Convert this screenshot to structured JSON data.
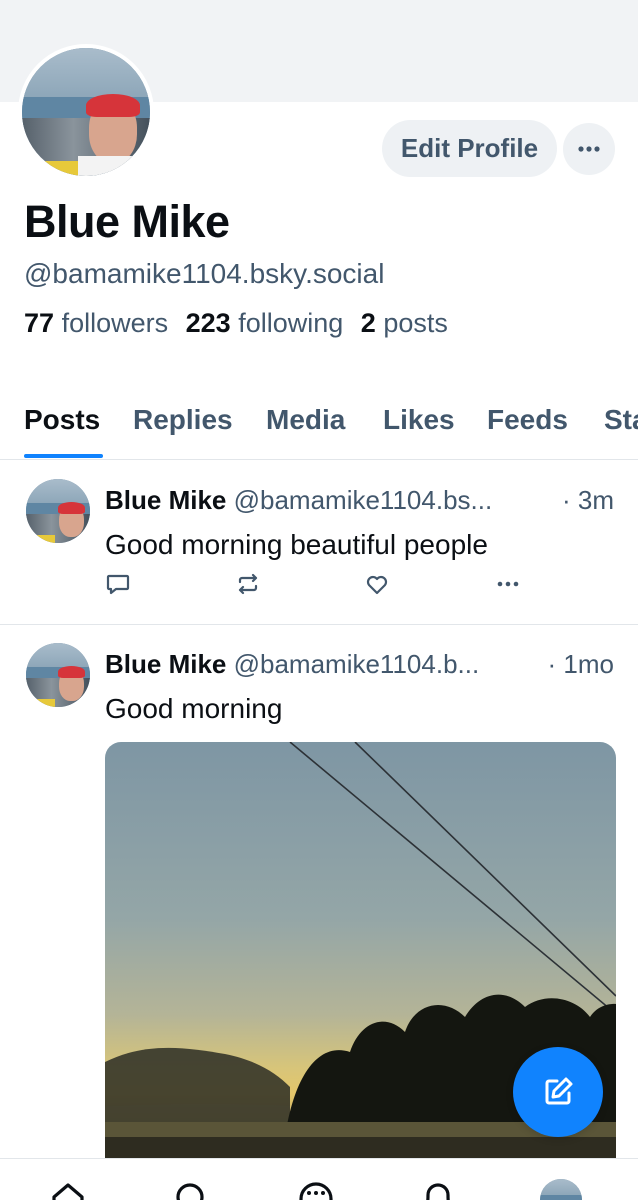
{
  "profile": {
    "name": "Blue Mike",
    "handle": "@bamamike1104.bsky.social",
    "followers_count": "77",
    "followers_label": "followers",
    "following_count": "223",
    "following_label": "following",
    "posts_count": "2",
    "posts_label": "posts",
    "edit_label": "Edit Profile",
    "more_label": "···"
  },
  "tabs": [
    {
      "label": "Posts",
      "active": true
    },
    {
      "label": "Replies"
    },
    {
      "label": "Media"
    },
    {
      "label": "Likes"
    },
    {
      "label": "Feeds"
    },
    {
      "label": "Sta"
    }
  ],
  "posts": [
    {
      "author": "Blue Mike",
      "handle": "@bamamike1104.bs...",
      "time": "· 3m",
      "text": "Good morning beautiful people"
    },
    {
      "author": "Blue Mike",
      "handle": "@bamamike1104.b...",
      "time": "· 1mo",
      "text": "Good morning"
    }
  ],
  "icons": {
    "post_actions": [
      "reply-icon",
      "repost-icon",
      "like-icon",
      "more-icon"
    ],
    "bottom_nav": [
      "home-icon",
      "search-icon",
      "chat-icon",
      "notifications-icon",
      "profile-avatar"
    ],
    "fab": "compose-icon"
  },
  "colors": {
    "accent": "#1083fe",
    "secondary_text": "#42576c",
    "banner": "#f1f3f5"
  }
}
